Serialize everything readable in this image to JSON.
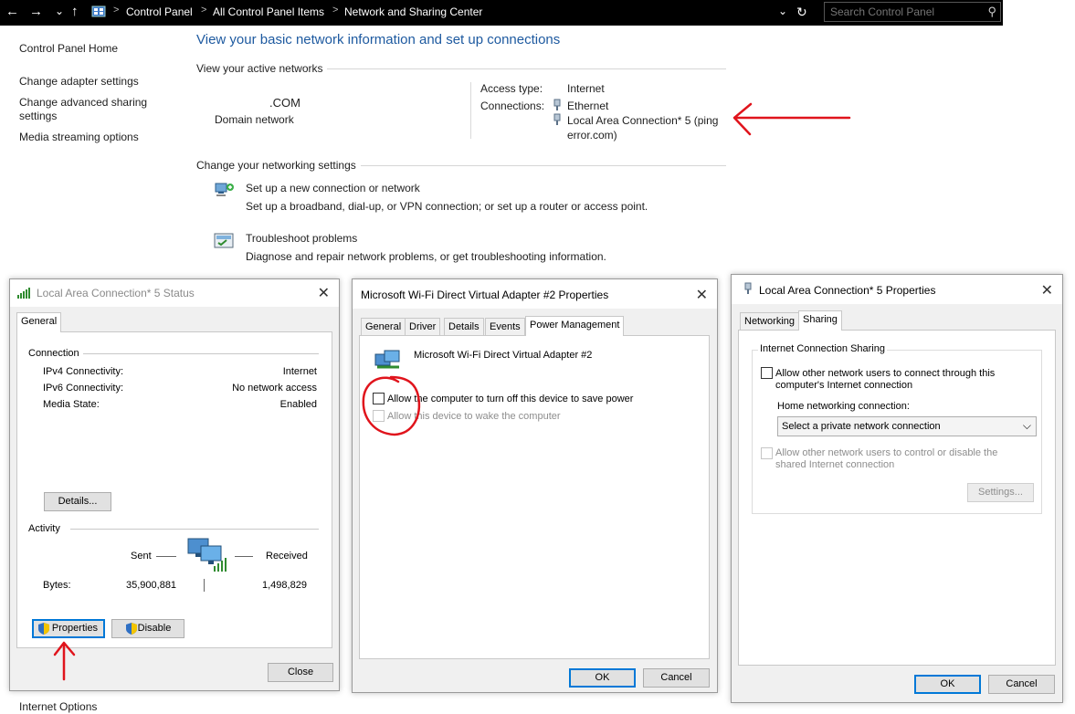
{
  "address_bar": {
    "back": "←",
    "forward": "→",
    "recent": "⌄",
    "up": "↑",
    "breadcrumbs": [
      "Control Panel",
      "All Control Panel Items",
      "Network and Sharing Center"
    ],
    "dropdown": "⌄",
    "refresh": "↻",
    "search_placeholder": "Search Control Panel",
    "search_glyph": "⚲"
  },
  "sidebar": {
    "items": [
      "Control Panel Home",
      "Change adapter settings",
      "Change advanced sharing",
      "settings",
      "Media streaming options"
    ],
    "cut_off_item": "Internet Options"
  },
  "main": {
    "title": "View your basic network information and set up connections",
    "active_networks_label": "View your active networks",
    "network_name": ".COM",
    "network_type": "Domain network",
    "access_type_label": "Access type:",
    "access_type_value": "Internet",
    "connections_label": "Connections:",
    "connection_1": "Ethernet",
    "connection_2_line1": "Local Area Connection* 5 (ping",
    "connection_2_line2": "error.com)",
    "change_settings_label": "Change your networking settings",
    "setup_link": "Set up a new connection or network",
    "setup_desc": "Set up a broadband, dial-up, or VPN connection; or set up a router or access point.",
    "troubleshoot_link": "Troubleshoot problems",
    "troubleshoot_desc": "Diagnose and repair network problems, or get troubleshooting information."
  },
  "status_dialog": {
    "title": "Local Area Connection* 5 Status",
    "tab": "General",
    "connection_group": "Connection",
    "rows": [
      {
        "label": "IPv4 Connectivity:",
        "value": "Internet"
      },
      {
        "label": "IPv6 Connectivity:",
        "value": "No network access"
      },
      {
        "label": "Media State:",
        "value": "Enabled"
      }
    ],
    "details_button": "Details...",
    "activity_group": "Activity",
    "sent_label": "Sent",
    "received_label": "Received",
    "bytes_label": "Bytes:",
    "bytes_sent": "35,900,881",
    "bytes_received": "1,498,829",
    "properties_button": "Properties",
    "disable_button": "Disable",
    "close_button": "Close"
  },
  "adapter_dialog": {
    "title": "Microsoft Wi-Fi Direct Virtual Adapter #2 Properties",
    "tabs": [
      "General",
      "Driver",
      "Details",
      "Events",
      "Power Management"
    ],
    "device_name": "Microsoft Wi-Fi Direct Virtual Adapter #2",
    "option_1": "Allow the computer to turn off this device to save power",
    "option_2": "Allow this device to wake the computer",
    "ok_button": "OK",
    "cancel_button": "Cancel"
  },
  "properties_dialog": {
    "title": "Local Area Connection* 5 Properties",
    "tabs": [
      "Networking",
      "Sharing"
    ],
    "ics_group": "Internet Connection Sharing",
    "allow_connect_line1": "Allow other network users to connect through this",
    "allow_connect_line2": "computer's Internet connection",
    "home_conn_label": "Home networking connection:",
    "home_conn_value": "Select a private network connection",
    "allow_control_line1": "Allow other network users to control or disable the",
    "allow_control_line2": "shared Internet connection",
    "settings_button": "Settings...",
    "ok_button": "OK",
    "cancel_button": "Cancel"
  },
  "glyphs": {
    "close": "✕",
    "chevron": "⌵"
  },
  "colors": {
    "link": "#1c5fb1",
    "heading": "#1e5aa0",
    "annotation": "#e0141c",
    "focus": "#0078d7"
  }
}
